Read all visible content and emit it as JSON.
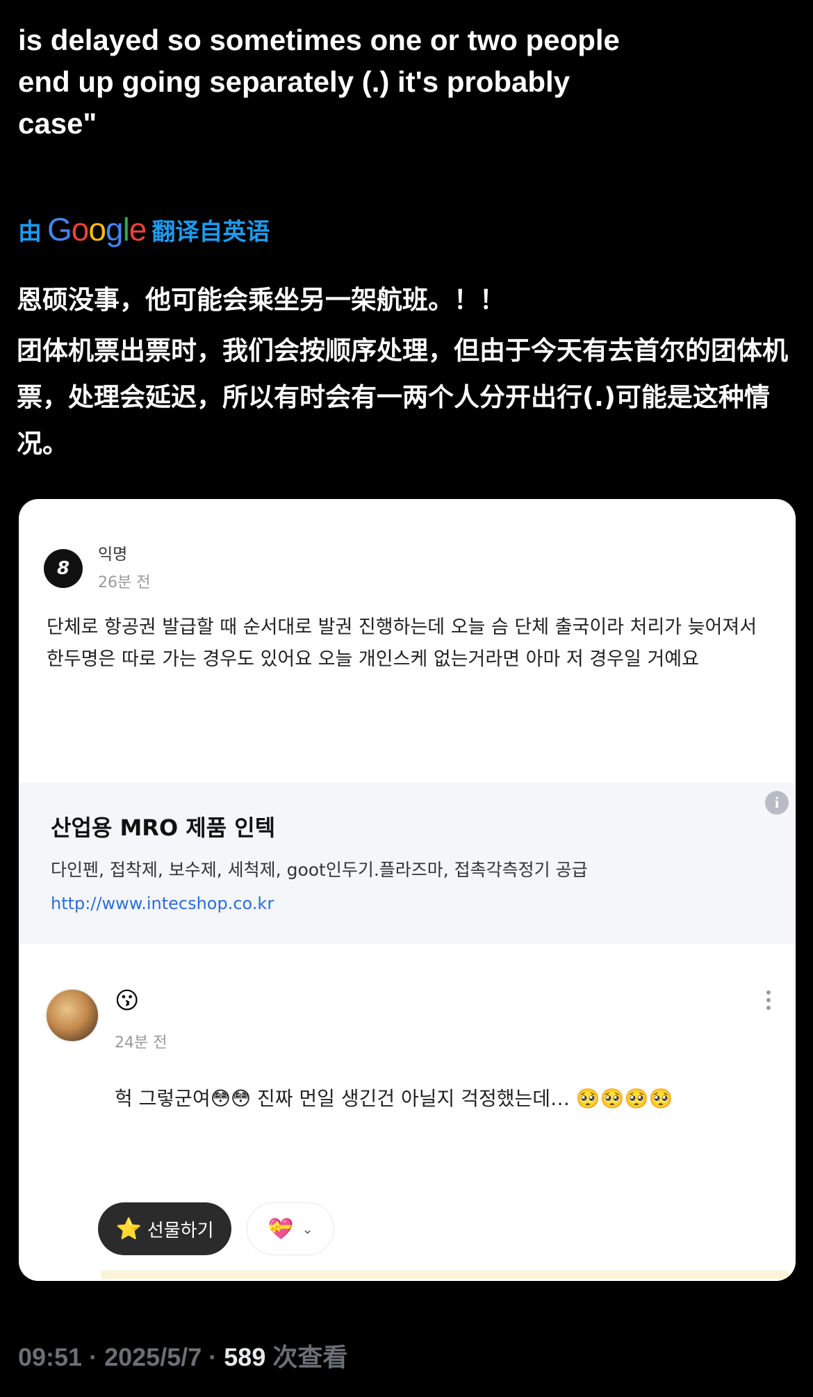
{
  "tweet": {
    "english_lines": [
      "is delayed so sometimes one or two people",
      "end up going separately (.) it's probably",
      "case\""
    ],
    "translate_prefix": "由",
    "translate_brand": "Google",
    "translate_suffix": "翻译自英语",
    "zh_line1": "恩硕没事，他可能会乘坐另一架航班。！！",
    "zh_line2": "团体机票出票时，我们会按顺序处理，但由于今天有去首尔的团体机票，处理会延迟，所以有时会有一两个人分开出行(.)可能是这种情况。",
    "time": "09:51",
    "date": "2025/5/7",
    "separator": "·",
    "views": "589",
    "views_label": "次查看"
  },
  "embedded": {
    "post": {
      "avatar_glyph": "8",
      "author": "익명",
      "time": "26분 전",
      "body": "단체로 항공권 발급할 때 순서대로 발권 진행하는데 오늘 슴 단체 출국이라 처리가 늦어져서 한두명은 따로 가는 경우도 있어요 오늘 개인스케 없는거라면 아마 저 경우일 거예요"
    },
    "ad": {
      "title": "산업용 MRO 제품 인텍",
      "description": "다인펜, 접착제, 보수제, 세척제, goot인두기.플라즈마, 접촉각측정기 공급",
      "url": "http://www.intecshop.co.kr",
      "info_glyph": "i"
    },
    "comment": {
      "author_emoji": "😗",
      "time": "24분 전",
      "body": "헉 그렇군여😳😳 진짜 먼일 생긴건 아닐지 걱정했는데… 🥺🥺🥺🥺",
      "gift_label": "선물하기",
      "gift_icon": "⭐",
      "reaction_icon": "💝",
      "chevron_icon": "⌄"
    }
  }
}
